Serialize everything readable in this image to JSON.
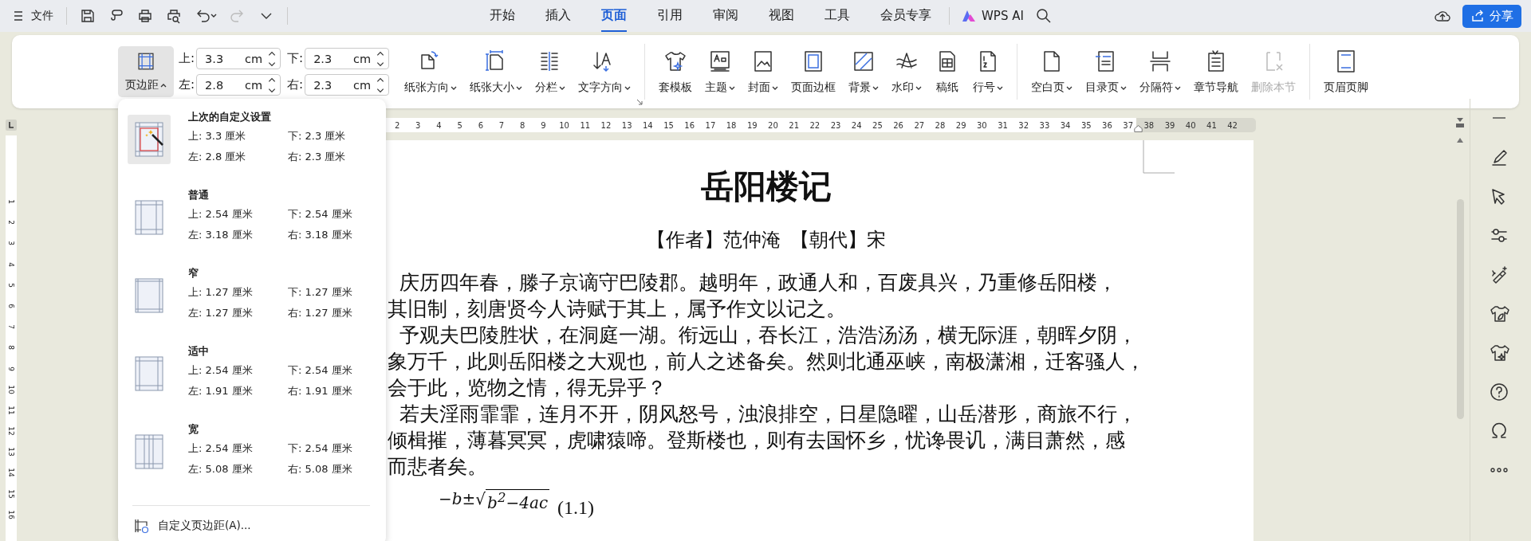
{
  "menu": {
    "label": "文件"
  },
  "tabs": [
    {
      "label": "开始",
      "selected": false
    },
    {
      "label": "插入",
      "selected": false
    },
    {
      "label": "页面",
      "selected": true
    },
    {
      "label": "引用",
      "selected": false
    },
    {
      "label": "审阅",
      "selected": false
    },
    {
      "label": "视图",
      "selected": false
    },
    {
      "label": "工具",
      "selected": false
    },
    {
      "label": "会员专享",
      "selected": false
    }
  ],
  "ai": {
    "label": "WPS AI"
  },
  "share": {
    "label": "分享"
  },
  "ribbon": {
    "margin_button": {
      "label": "页边距",
      "expanded": true
    },
    "margin_fields": [
      {
        "label": "上:",
        "value": "3.3",
        "unit": "cm"
      },
      {
        "label": "下:",
        "value": "2.3",
        "unit": "cm"
      },
      {
        "label": "左:",
        "value": "2.8",
        "unit": "cm"
      },
      {
        "label": "右:",
        "value": "2.3",
        "unit": "cm"
      }
    ],
    "groups": [
      [
        {
          "label": "纸张方向",
          "dropdown": true,
          "disabled": false
        },
        {
          "label": "纸张大小",
          "dropdown": true,
          "disabled": false
        },
        {
          "label": "分栏",
          "dropdown": true,
          "disabled": false
        },
        {
          "label": "文字方向",
          "dropdown": true,
          "disabled": false
        }
      ],
      [
        {
          "label": "套模板",
          "dropdown": false,
          "disabled": false
        },
        {
          "label": "主题",
          "dropdown": true,
          "disabled": false
        },
        {
          "label": "封面",
          "dropdown": true,
          "disabled": false
        },
        {
          "label": "页面边框",
          "dropdown": false,
          "disabled": false
        },
        {
          "label": "背景",
          "dropdown": true,
          "disabled": false
        },
        {
          "label": "水印",
          "dropdown": true,
          "disabled": false
        },
        {
          "label": "稿纸",
          "dropdown": false,
          "disabled": false
        },
        {
          "label": "行号",
          "dropdown": true,
          "disabled": false
        }
      ],
      [
        {
          "label": "空白页",
          "dropdown": true,
          "disabled": false
        },
        {
          "label": "目录页",
          "dropdown": true,
          "disabled": false
        },
        {
          "label": "分隔符",
          "dropdown": true,
          "disabled": false
        },
        {
          "label": "章节导航",
          "dropdown": false,
          "disabled": false
        },
        {
          "label": "删除本节",
          "dropdown": false,
          "disabled": true
        }
      ],
      [
        {
          "label": "页眉页脚",
          "dropdown": false,
          "disabled": false
        }
      ]
    ]
  },
  "ruler": {
    "numbers": [
      "2",
      "3",
      "4",
      "5",
      "6",
      "7",
      "8",
      "9",
      "10",
      "11",
      "12",
      "13",
      "14",
      "15",
      "16",
      "17",
      "18",
      "19",
      "20",
      "21",
      "22",
      "23",
      "24",
      "25",
      "26",
      "27",
      "28",
      "29",
      "30",
      "31",
      "32",
      "33",
      "34",
      "35",
      "36",
      "37",
      "38",
      "39",
      "40",
      "41",
      "42"
    ]
  },
  "vertical_ruler": {
    "numbers": [
      "1",
      "2",
      "3",
      "4",
      "5",
      "6",
      "7",
      "8",
      "9",
      "10",
      "11",
      "12",
      "13",
      "14",
      "15",
      "16"
    ]
  },
  "margin_menu": {
    "presets": [
      {
        "title": "上次的自定义设置",
        "selected": true,
        "values": [
          "上: 3.3 厘米",
          "下: 2.3 厘米",
          "左: 2.8 厘米",
          "右: 2.3 厘米"
        ]
      },
      {
        "title": "普通",
        "selected": false,
        "values": [
          "上: 2.54 厘米",
          "下: 2.54 厘米",
          "左: 3.18 厘米",
          "右: 3.18 厘米"
        ]
      },
      {
        "title": "窄",
        "selected": false,
        "values": [
          "上: 1.27 厘米",
          "下: 1.27 厘米",
          "左: 1.27 厘米",
          "右: 1.27 厘米"
        ]
      },
      {
        "title": "适中",
        "selected": false,
        "values": [
          "上: 2.54 厘米",
          "下: 2.54 厘米",
          "左: 1.91 厘米",
          "右: 1.91 厘米"
        ]
      },
      {
        "title": "宽",
        "selected": false,
        "values": [
          "上: 2.54 厘米",
          "下: 2.54 厘米",
          "左: 5.08 厘米",
          "右: 5.08 厘米"
        ]
      }
    ],
    "custom": {
      "label": "自定义页边距(A)..."
    }
  },
  "document": {
    "title": "岳阳楼记",
    "byline": "【作者】范仲淹  【朝代】宋",
    "paragraphs": [
      {
        "lines": [
          "庆历四年春，滕子京谪守巴陵郡。越明年，政通人和，百废具兴，乃重修岳阳楼，",
          "其旧制，刻唐贤今人诗赋于其上，属予作文以记之。"
        ]
      },
      {
        "lines": [
          "予观夫巴陵胜状，在洞庭一湖。衔远山，吞长江，浩浩汤汤，横无际涯，朝晖夕阴，",
          "象万千，此则岳阳楼之大观也，前人之述备矣。然则北通巫峡，南极潇湘，迁客骚人，",
          "会于此，览物之情，得无异乎？"
        ]
      },
      {
        "lines": [
          "若夫淫雨霏霏，连月不开，阴风怒号，浊浪排空，日星隐曜，山岳潜形，商旅不行，",
          "倾楫摧，薄暮冥冥，虎啸猿啼。登斯楼也，则有去国怀乡，忧谗畏讥，满目萧然，感",
          "而悲者矣。"
        ]
      }
    ],
    "formula": {
      "prefix": "−b±√",
      "radicand": "b$^{2}$−4ac",
      "label": "(1.1)"
    }
  }
}
